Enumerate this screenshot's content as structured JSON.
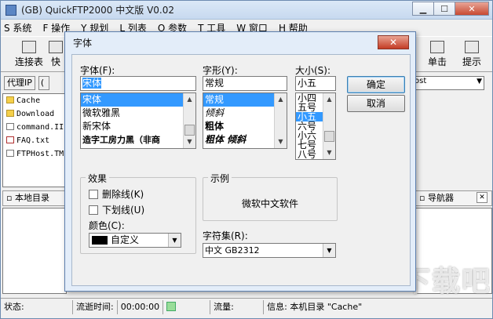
{
  "app": {
    "title": "(GB) QuickFTP2000 中文版 V0.02"
  },
  "menu": [
    "S 系统",
    "F 操作",
    "Y 规划",
    "L 列表",
    "O 参数",
    "T 工具",
    "W 窗口",
    "H 帮助"
  ],
  "toolbar": {
    "connect": "连接表",
    "quick": "快",
    "single": "单击",
    "hint": "提示"
  },
  "proxy": {
    "label": "代理IP",
    "field": "(",
    "combo": "ost"
  },
  "files": [
    {
      "name": "Cache",
      "type": "folder"
    },
    {
      "name": "Download",
      "type": "folder"
    },
    {
      "name": "command.II",
      "type": "file"
    },
    {
      "name": "FAQ.txt",
      "type": "red"
    },
    {
      "name": "FTPHost.TM",
      "type": "file"
    }
  ],
  "panels": {
    "local": "本地目录",
    "navigator": "导航器"
  },
  "status": {
    "state_label": "状态:",
    "elapsed_label": "流逝时间:",
    "elapsed_value": "00:00:00",
    "flow_label": "流量:",
    "info": "信息: 本机目录 \"Cache\""
  },
  "dialog": {
    "title": "字体",
    "font_label": "字体(F):",
    "font_value": "宋体",
    "font_list": [
      "宋体",
      "微软雅黑",
      "新宋体",
      "造字工房力黑（非商"
    ],
    "style_label": "字形(Y):",
    "style_value": "常规",
    "style_list": [
      "常规",
      "倾斜",
      "粗体",
      "粗体 倾斜"
    ],
    "size_label": "大小(S):",
    "size_value": "小五",
    "size_list": [
      "小四",
      "五号",
      "小五",
      "六号",
      "小六",
      "七号",
      "八号"
    ],
    "ok": "确定",
    "cancel": "取消",
    "effects_label": "效果",
    "strike_label": "删除线(K)",
    "underline_label": "下划线(U)",
    "color_label": "颜色(C):",
    "color_value": "自定义",
    "sample_label": "示例",
    "sample_text": "微软中文软件",
    "charset_label": "字符集(R):",
    "charset_value": "中文 GB2312"
  },
  "watermark": "下载吧"
}
